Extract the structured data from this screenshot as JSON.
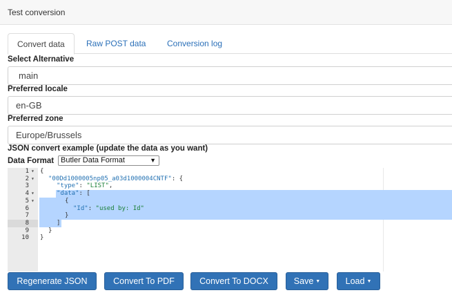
{
  "window": {
    "title": "Test conversion"
  },
  "tabs": [
    {
      "label": "Convert data"
    },
    {
      "label": "Raw POST data"
    },
    {
      "label": "Conversion log"
    }
  ],
  "form": {
    "alternative_label": "Select Alternative",
    "alternative_value": "main",
    "locale_label": "Preferred locale",
    "locale_value": "en-GB",
    "zone_label": "Preferred zone",
    "zone_value": "Europe/Brussels",
    "json_label": "JSON convert example (update the data as you want)",
    "format_label": "Data Format",
    "format_value": "Butler Data Format"
  },
  "editor": {
    "lines": [
      {
        "no": "1",
        "fold": "▾"
      },
      {
        "no": "2",
        "fold": "▾"
      },
      {
        "no": "3",
        "fold": ""
      },
      {
        "no": "4",
        "fold": "▾"
      },
      {
        "no": "5",
        "fold": "▾"
      },
      {
        "no": "6",
        "fold": ""
      },
      {
        "no": "7",
        "fold": ""
      },
      {
        "no": "8",
        "fold": ""
      },
      {
        "no": "9",
        "fold": ""
      },
      {
        "no": "10",
        "fold": ""
      }
    ],
    "code": {
      "l1": "{",
      "l2_key": "\"00Dd1000005np05_a03d1000004CNTF\"",
      "l2_rest": ": {",
      "l3_key": "\"type\"",
      "l3_sep": ": ",
      "l3_val": "\"LIST\"",
      "l3_end": ",",
      "l4_key": "\"data\"",
      "l4_rest": ": [",
      "l5": "{",
      "l6_key": "\"Id\"",
      "l6_sep": ": ",
      "l6_val": "\"used by: Id\"",
      "l7": "}",
      "l8": "]",
      "l9": "}",
      "l10": "}"
    }
  },
  "buttons": {
    "regenerate": "Regenerate JSON",
    "pdf": "Convert To PDF",
    "docx": "Convert To DOCX",
    "save": "Save",
    "load": "Load"
  },
  "colors": {
    "accent": "#3172b6",
    "link": "#2a6fb8",
    "selection": "#b5d5ff"
  }
}
